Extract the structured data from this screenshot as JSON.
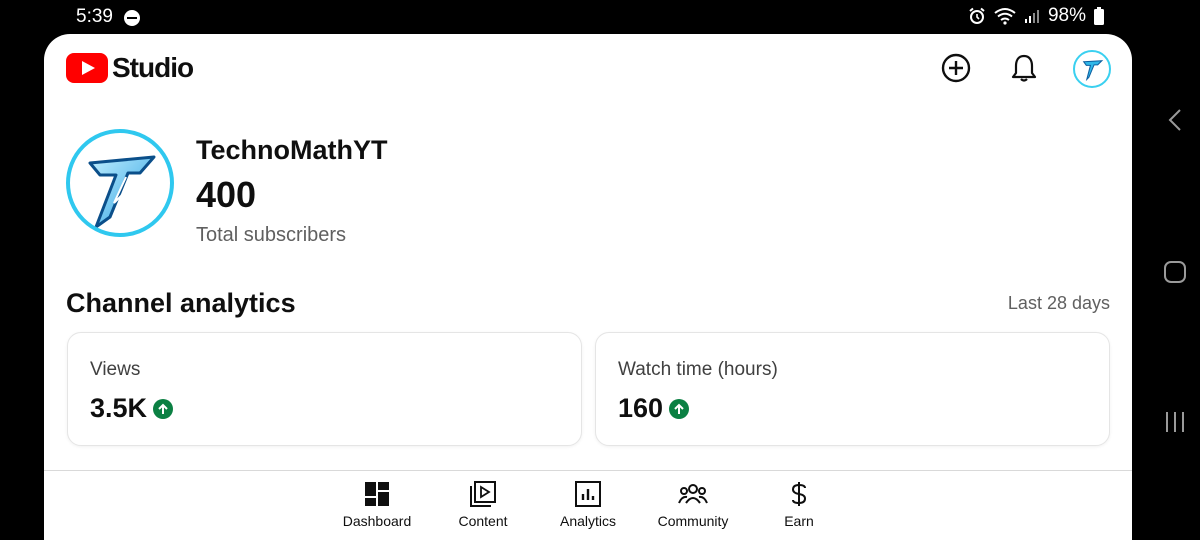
{
  "status_bar": {
    "time": "5:39",
    "battery": "98%"
  },
  "header": {
    "logo_text": "Studio",
    "icons": {
      "create": "create-plus-icon",
      "notifications": "bell-icon",
      "account": "channel-avatar"
    }
  },
  "channel": {
    "name": "TechnoMathYT",
    "subscribers": "400",
    "subscribers_label": "Total subscribers"
  },
  "analytics": {
    "title": "Channel analytics",
    "period": "Last 28 days",
    "cards": [
      {
        "label": "Views",
        "value": "3.5K",
        "trend": "up"
      },
      {
        "label": "Watch time (hours)",
        "value": "160",
        "trend": "up"
      }
    ]
  },
  "bottom_nav": [
    {
      "label": "Dashboard",
      "icon": "dashboard-icon"
    },
    {
      "label": "Content",
      "icon": "content-icon"
    },
    {
      "label": "Analytics",
      "icon": "analytics-icon"
    },
    {
      "label": "Community",
      "icon": "community-icon"
    },
    {
      "label": "Earn",
      "icon": "earn-icon"
    }
  ],
  "colors": {
    "brand_red": "#ff0000",
    "trend_green": "#0b8043",
    "avatar_ring": "#2fc8ef"
  }
}
